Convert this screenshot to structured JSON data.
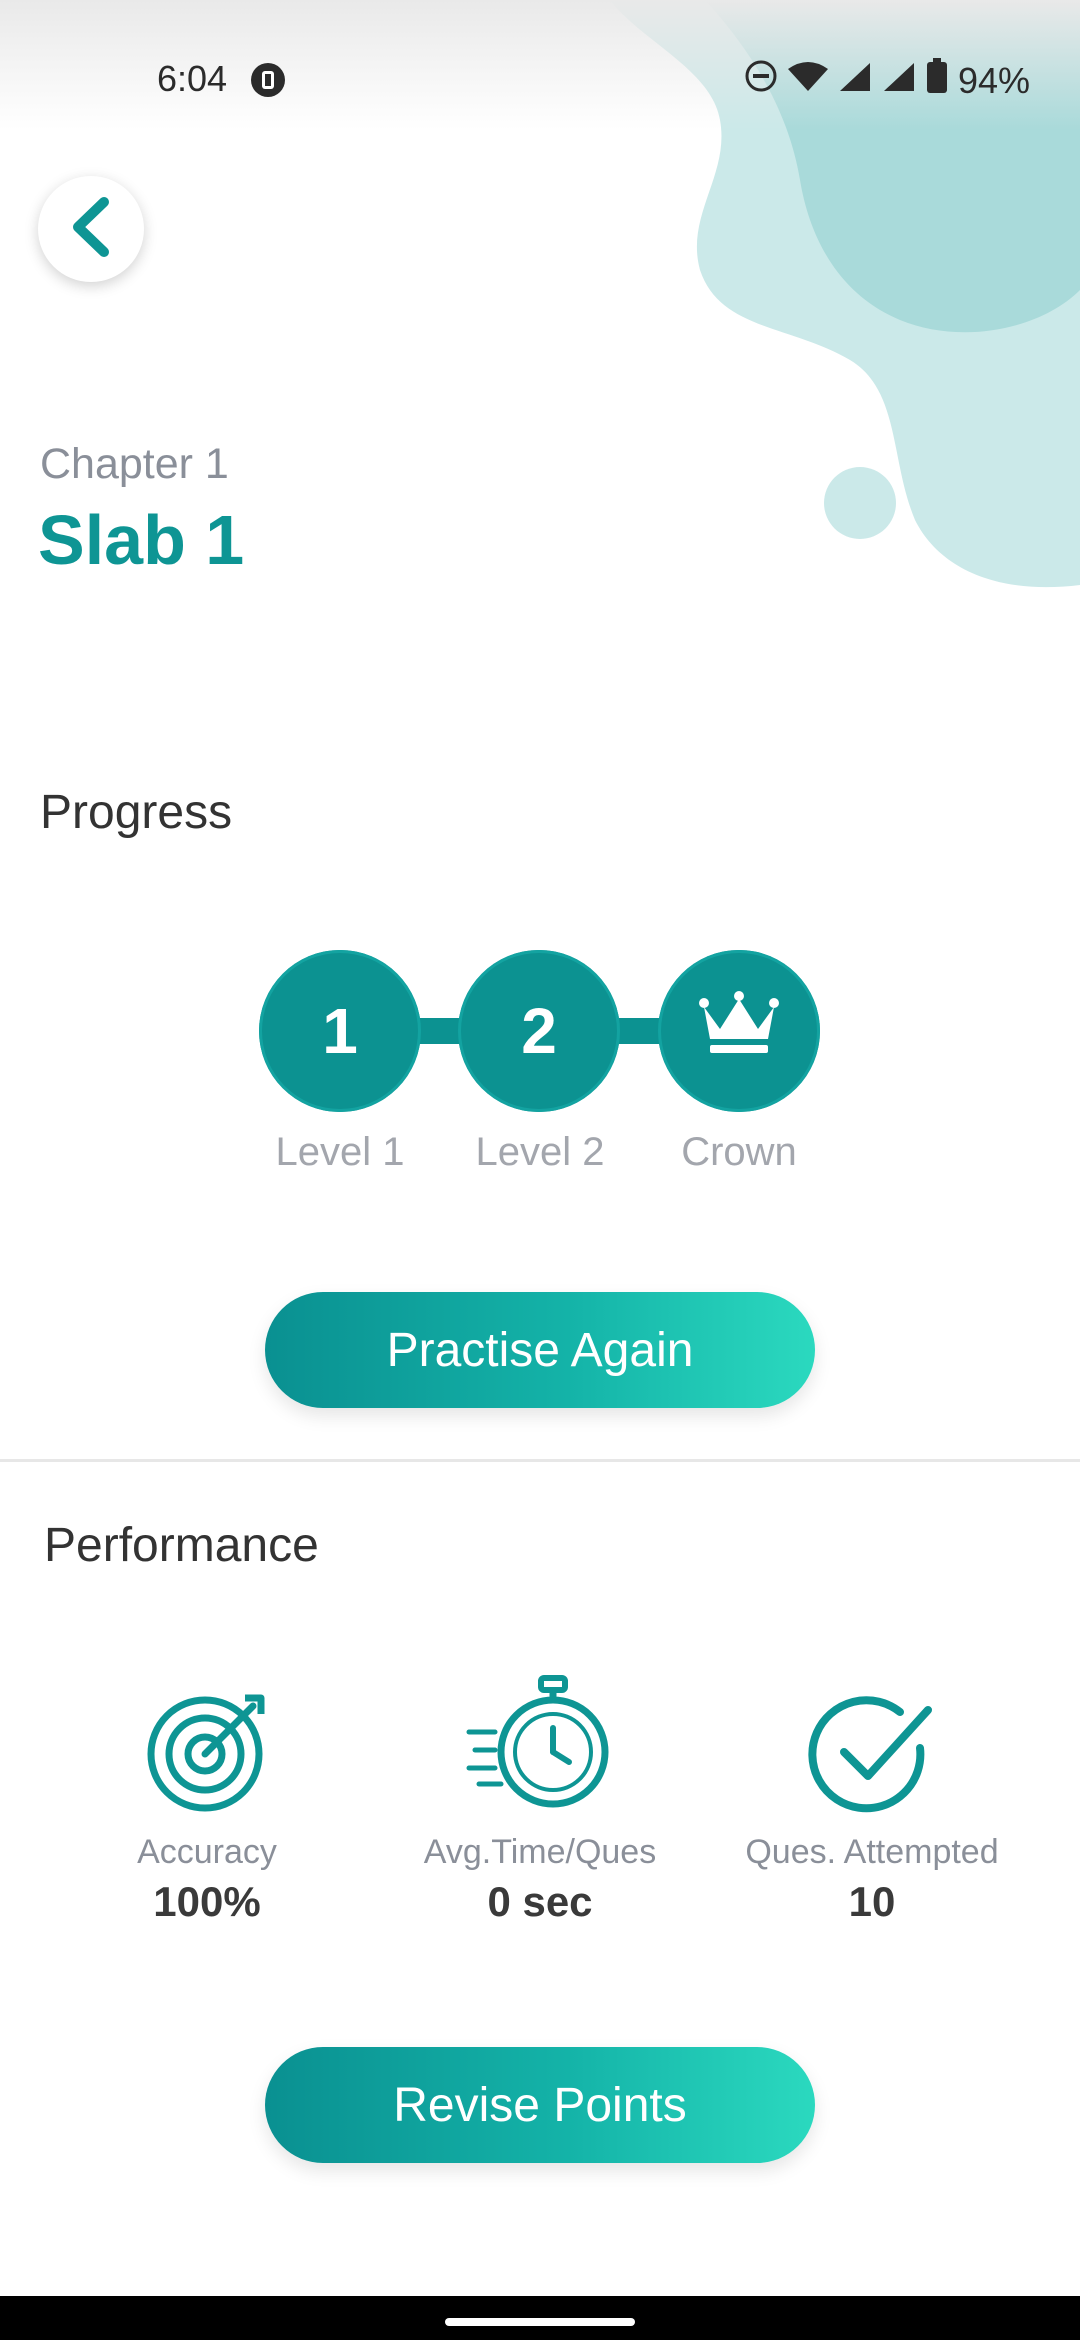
{
  "status_bar": {
    "time": "6:04",
    "battery": "94%"
  },
  "header": {
    "chapter": "Chapter 1",
    "title": "Slab 1"
  },
  "progress": {
    "heading": "Progress",
    "levels": [
      {
        "badge": "1",
        "label": "Level 1"
      },
      {
        "badge": "2",
        "label": "Level 2"
      },
      {
        "badge": "",
        "label": "Crown",
        "icon": "crown-icon"
      }
    ],
    "button": "Practise Again"
  },
  "performance": {
    "heading": "Performance",
    "stats": [
      {
        "label": "Accuracy",
        "value": "100%",
        "icon": "target-icon"
      },
      {
        "label": "Avg.Time/Ques",
        "value": "0 sec",
        "icon": "stopwatch-icon"
      },
      {
        "label": "Ques. Attempted",
        "value": "10",
        "icon": "checkmark-icon"
      }
    ],
    "button": "Revise Points"
  },
  "colors": {
    "accent": "#0e9594",
    "blob": "#c9e8e8",
    "blob_dark": "#a6d8d8"
  }
}
